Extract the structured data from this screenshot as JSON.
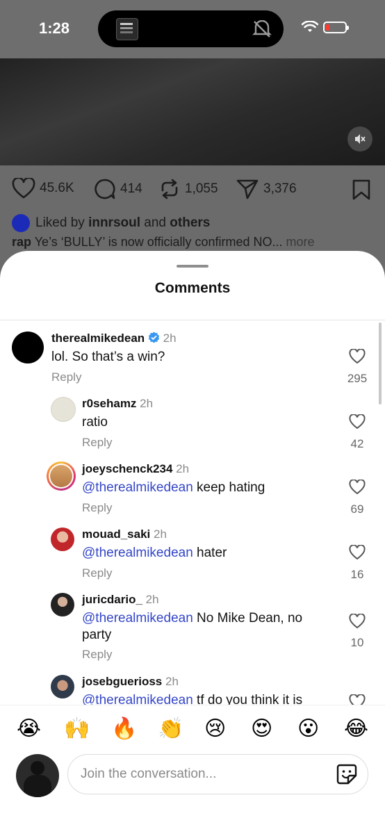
{
  "status_bar": {
    "time": "1:28"
  },
  "post": {
    "likes": "45.6K",
    "comments": "414",
    "reposts": "1,055",
    "shares": "3,376",
    "liked_by_prefix": "Liked by",
    "liked_by_user": "innrsoul",
    "liked_by_and": "and",
    "liked_by_others": "others",
    "caption_user": "rap",
    "caption_text": "Ye’s ‘BULLY’ is now officially confirmed NO...",
    "caption_more": "more"
  },
  "sheet": {
    "title": "Comments"
  },
  "comments": [
    {
      "username": "therealmikedean",
      "verified": true,
      "time": "2h",
      "mention": "",
      "text": "lol. So that’s a win?",
      "reply": "Reply",
      "likes": "295"
    },
    {
      "username": "r0sehamz",
      "time": "2h",
      "mention": "",
      "text": "ratio",
      "reply": "Reply",
      "likes": "42"
    },
    {
      "username": "joeyschenck234",
      "time": "2h",
      "mention": "@therealmikedean",
      "text": "keep hating",
      "reply": "Reply",
      "likes": "69"
    },
    {
      "username": "mouad_saki",
      "time": "2h",
      "mention": "@therealmikedean",
      "text": "hater",
      "reply": "Reply",
      "likes": "16"
    },
    {
      "username": "juricdario_",
      "time": "2h",
      "mention": "@therealmikedean",
      "text": "No Mike Dean, no party",
      "reply": "Reply",
      "likes": "10"
    },
    {
      "username": "josebguerioss",
      "time": "2h",
      "mention": "@therealmikedean",
      "text": "tf do you think it is",
      "reply": "",
      "likes": ""
    }
  ],
  "emoji_bar": [
    "😭",
    "🙌",
    "🔥",
    "👏",
    "😢",
    "😍",
    "😮",
    "😂"
  ],
  "composer": {
    "placeholder": "Join the conversation..."
  },
  "colors": {
    "mention": "#3446c7",
    "verified": "#3897f0",
    "battery_low": "#ff3b30"
  }
}
